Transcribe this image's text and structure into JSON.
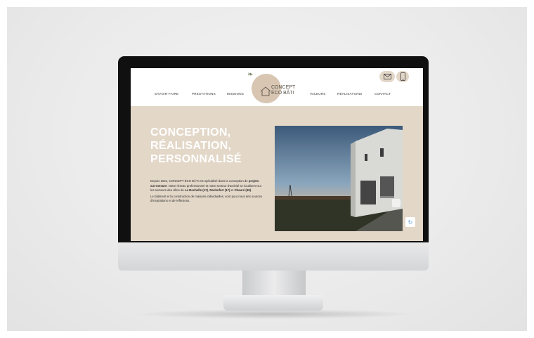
{
  "nav": {
    "left": [
      "SAVOIR-FAIRE",
      "PRESTATIONS",
      "MISSIONS"
    ],
    "right": [
      "VALEURS",
      "RÉALISATIONS",
      "CONTACT"
    ]
  },
  "logo": {
    "line1": "CONCEPT",
    "line2": "ÉCO BÂTI"
  },
  "header_icons": [
    "mail-icon",
    "phone-icon"
  ],
  "hero": {
    "title_lines": [
      "CONCEPTION,",
      "RÉALISATION,",
      "PERSONNALISÉ"
    ],
    "paragraph1": {
      "t1": "Depuis 2021, CONCEPT ÉCO BÂTI est spécialisé dans la conception de ",
      "b1": "projets sur-mesure",
      "t2": ". Notre réseau professionnel et notre secteur d'activité se localisent sur les secteurs des villes de ",
      "b2": "La Rochelle (17)",
      "t3": ", ",
      "b3": "Rochefort (17)",
      "t4": " et ",
      "b4": "Chauré (49)",
      "t5": "."
    },
    "paragraph2": "Le bâtiment et la construction de maisons individuelles, sont pour nous des sources d'inspirations et de réflexions."
  },
  "colors": {
    "screen_bg": "#e3d7c8",
    "accent": "#d8c6b3"
  }
}
